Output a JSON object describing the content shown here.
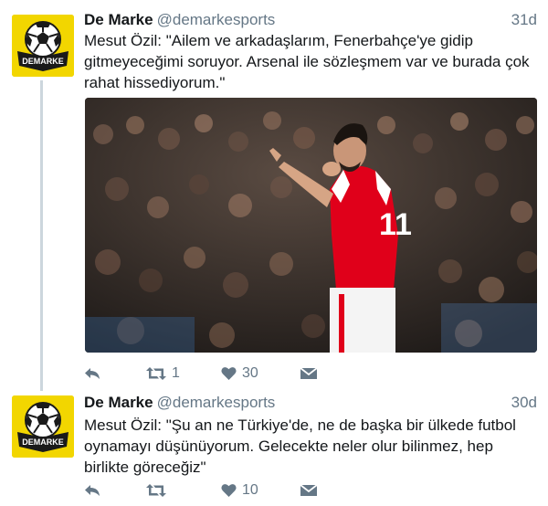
{
  "account": {
    "display_name": "De Marke",
    "handle": "@demarkesports",
    "avatar_text": "DEMARKE"
  },
  "tweets": [
    {
      "time": "31d",
      "text": "Mesut Özil: \"Ailem ve arkadaşlarım, Fenerbahçe'ye gidip gitmeyeceğimi soruyor. Arsenal ile sözleşmem var ve burada çok rahat hissediyorum.\"",
      "jersey_number": "11",
      "retweet_count": "1",
      "like_count": "30"
    },
    {
      "time": "30d",
      "text": "Mesut Özil: \"Şu an ne Türkiye'de, ne de başka bir ülkede futbol oynamayı düşünüyorum. Gelecekte neler olur bilinmez, hep birlikte göreceğiz\"",
      "retweet_count": "",
      "like_count": "10"
    }
  ],
  "colors": {
    "avatar_bg": "#f2d600",
    "thread_line": "#ccd6dd",
    "icon": "#657786",
    "jersey": "#e0001a"
  },
  "icons": [
    "reply-icon",
    "retweet-icon",
    "like-icon",
    "direct-message-icon",
    "soccer-ball-icon"
  ]
}
